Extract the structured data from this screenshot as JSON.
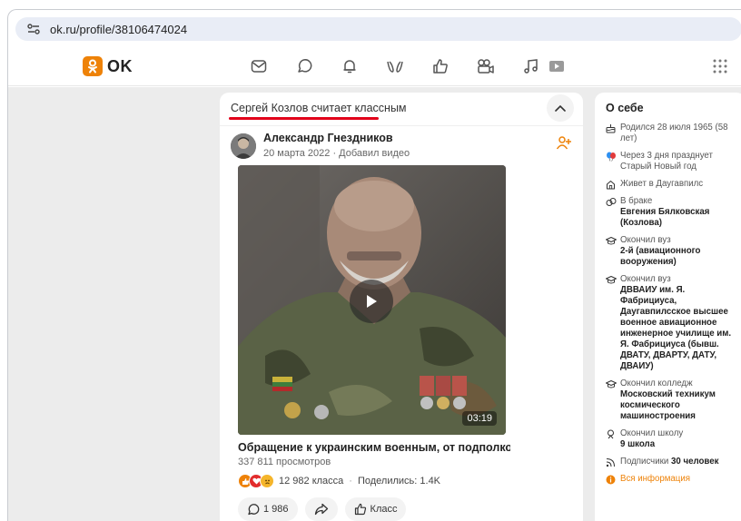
{
  "browser": {
    "url": "ok.ru/profile/38106474024"
  },
  "header": {
    "logo_text": "OK"
  },
  "feed": {
    "likes_heading": "Сергей Козлов считает классным",
    "post": {
      "author": "Александр Гнездников",
      "meta": "20 марта 2022 · Добавил видео",
      "video_duration": "03:19",
      "video_title": "Обращение к украинским военным, от подполковника ...",
      "views": "337 811 просмотров",
      "reactions_text": "12 982 класса",
      "share_text": "Поделились: 1.4K",
      "comments_count": "1 986",
      "class_label": "Класс"
    }
  },
  "about": {
    "title": "О себе",
    "birth": "Родился 28 июля 1965 (58 лет)",
    "holiday": "Через 3 дня празднует Старый Новый год",
    "lives": "Живет в Даугавпилс",
    "married_label": "В браке",
    "married_value": "Евгения Бялковская (Козлова)",
    "uni1_label": "Окончил вуз",
    "uni1_value": "2-й (авиационного вооружения)",
    "uni2_label": "Окончил вуз",
    "uni2_value": "ДВВАИУ им. Я. Фабрициуса, Даугавпилсское высшее военное авиационное инженерное училище им. Я. Фабрициуса (бывш. ДВАТУ, ДВАРТУ, ДАТУ, ДВАИУ)",
    "college_label": "Окончил колледж",
    "college_value": "Московский техникум космического машиностроения",
    "school_label": "Окончил школу",
    "school_value": "9 школа",
    "subs_prefix": "Подписчики",
    "subs_value": "30 человек",
    "all_info": "Вся информация"
  },
  "colors": {
    "accent": "#ee8208",
    "underline": "#e2001a"
  }
}
